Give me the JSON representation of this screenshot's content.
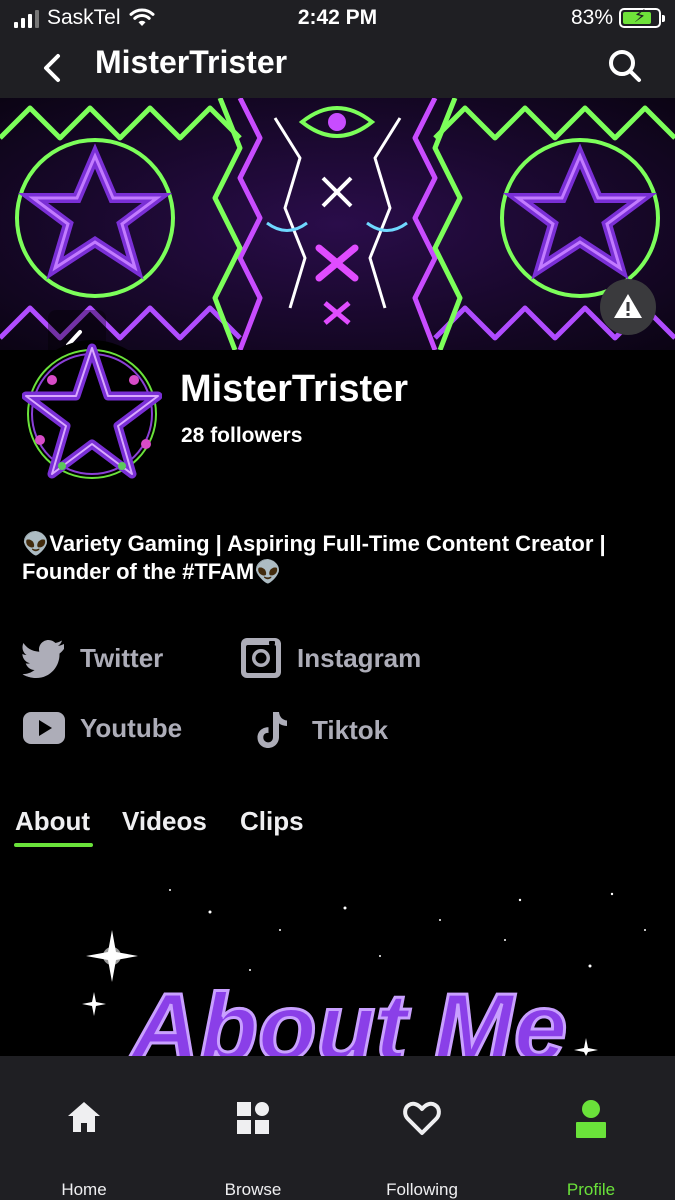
{
  "status_bar": {
    "carrier": "SaskTel",
    "time": "2:42 PM",
    "battery": "83%",
    "battery_level": 0.83
  },
  "nav": {
    "title": "MisterTrister",
    "back_icon": "chevron-left-icon",
    "search_icon": "search-icon"
  },
  "profile": {
    "name": "MisterTrister",
    "followers": "28 followers",
    "bio": "👽Variety Gaming | Aspiring Full-Time Content Creator | Founder of the #TFAM👽"
  },
  "social_links": [
    {
      "label": "Twitter",
      "icon": "twitter-icon"
    },
    {
      "label": "Instagram",
      "icon": "instagram-icon"
    },
    {
      "label": "Youtube",
      "icon": "youtube-icon"
    },
    {
      "label": "Tiktok",
      "icon": "tiktok-icon"
    }
  ],
  "tabs": [
    {
      "label": "About",
      "active": true
    },
    {
      "label": "Videos",
      "active": false
    },
    {
      "label": "Clips",
      "active": false
    }
  ],
  "about_image": {
    "text": "About Me"
  },
  "bottom_nav": [
    {
      "label": "Home",
      "icon": "home-icon",
      "active": false
    },
    {
      "label": "Browse",
      "icon": "browse-icon",
      "active": false
    },
    {
      "label": "Following",
      "icon": "heart-icon",
      "active": false
    },
    {
      "label": "Profile",
      "icon": "profile-icon",
      "active": true
    }
  ],
  "colors": {
    "accent": "#6ae23a",
    "bar_background": "#1f1f23",
    "link_gray": "#adadb8"
  }
}
